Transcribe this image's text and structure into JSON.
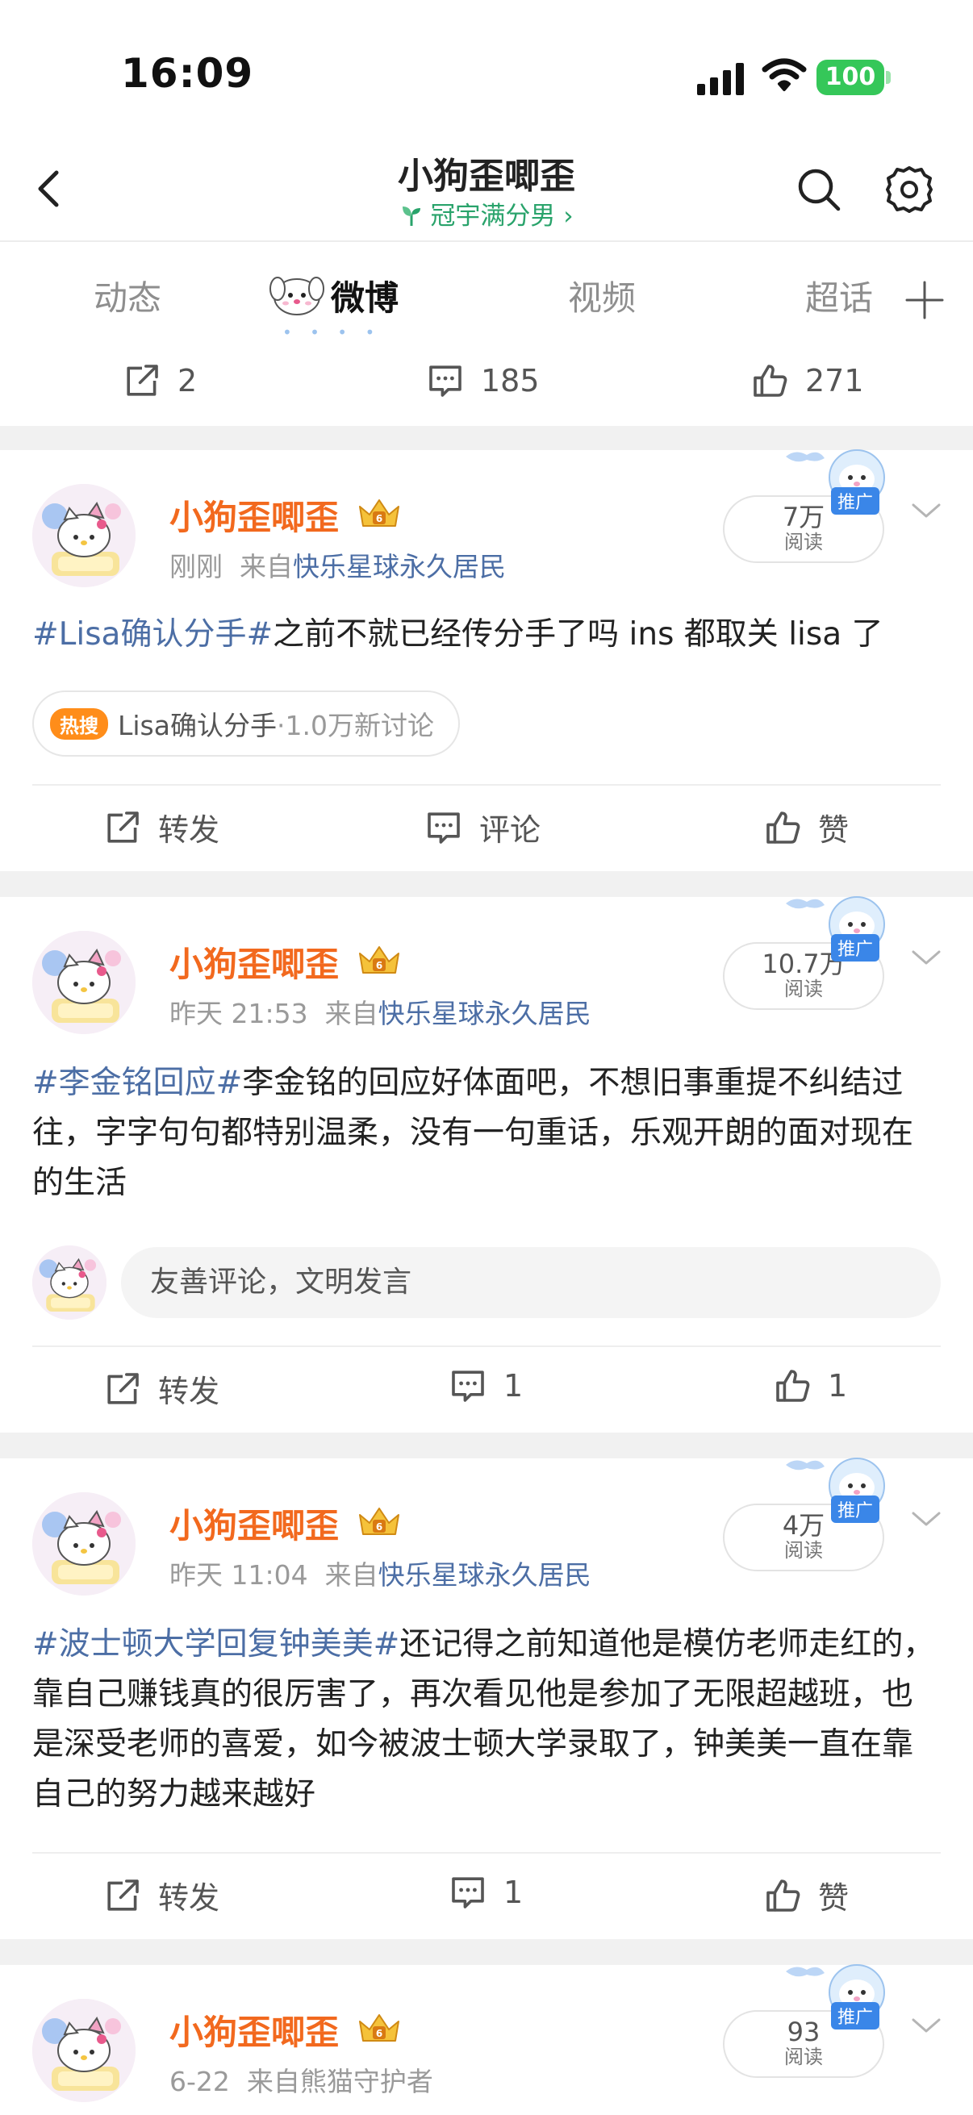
{
  "status": {
    "time": "16:09",
    "battery": "100"
  },
  "nav": {
    "title": "小狗歪唧歪",
    "subtitle": "冠宇满分男",
    "subtitle_arrow": "›"
  },
  "tabs": [
    "动态",
    "微博",
    "视频",
    "超话"
  ],
  "prev_post": {
    "repost_count": "2",
    "comment_count": "185",
    "like_count": "271"
  },
  "posts": [
    {
      "username": "小狗歪唧歪",
      "time": "刚刚",
      "source_prefix": "来自",
      "source": "快乐星球永久居民",
      "reads": "7万",
      "reads_label": "阅读",
      "promo_label": "推广",
      "hashtag": "#Lisa确认分手#",
      "text": "之前不就已经传分手了吗 ins 都取关 lisa 了",
      "hot_badge": "热搜",
      "hot_topic": "Lisa确认分手",
      "hot_count": "·1.0万新讨论",
      "repost": "转发",
      "comment": "评论",
      "like": "赞"
    },
    {
      "username": "小狗歪唧歪",
      "time": "昨天 21:53",
      "source_prefix": "来自",
      "source": "快乐星球永久居民",
      "reads": "10.7万",
      "reads_label": "阅读",
      "promo_label": "推广",
      "hashtag": "#李金铭回应#",
      "text": "李金铭的回应好体面吧，不想旧事重提不纠结过往，字字句句都特别温柔，没有一句重话，乐观开朗的面对现在的生活",
      "comment_placeholder": "友善评论，文明发言",
      "repost": "转发",
      "comment": "1",
      "like": "1"
    },
    {
      "username": "小狗歪唧歪",
      "time": "昨天 11:04",
      "source_prefix": "来自",
      "source": "快乐星球永久居民",
      "reads": "4万",
      "reads_label": "阅读",
      "promo_label": "推广",
      "hashtag": "#波士顿大学回复钟美美#",
      "text": "还记得之前知道他是模仿老师走红的，靠自己赚钱真的很厉害了，再次看见他是参加了无限超越班，也是深受老师的喜爱，如今被波士顿大学录取了，钟美美一直在靠自己的努力越来越好",
      "repost": "转发",
      "comment": "1",
      "like": "赞"
    },
    {
      "username": "小狗歪唧歪",
      "time": "6-22",
      "source_prefix": "来自",
      "source": "熊猫守护者",
      "reads": "93",
      "reads_label": "阅读",
      "promo_label": "推广"
    }
  ],
  "colors": {
    "username": "#f2691e",
    "link": "#4c6ea5",
    "accent_green": "#29a36b",
    "hot": "#ff8d1a",
    "battery": "#35c759"
  }
}
